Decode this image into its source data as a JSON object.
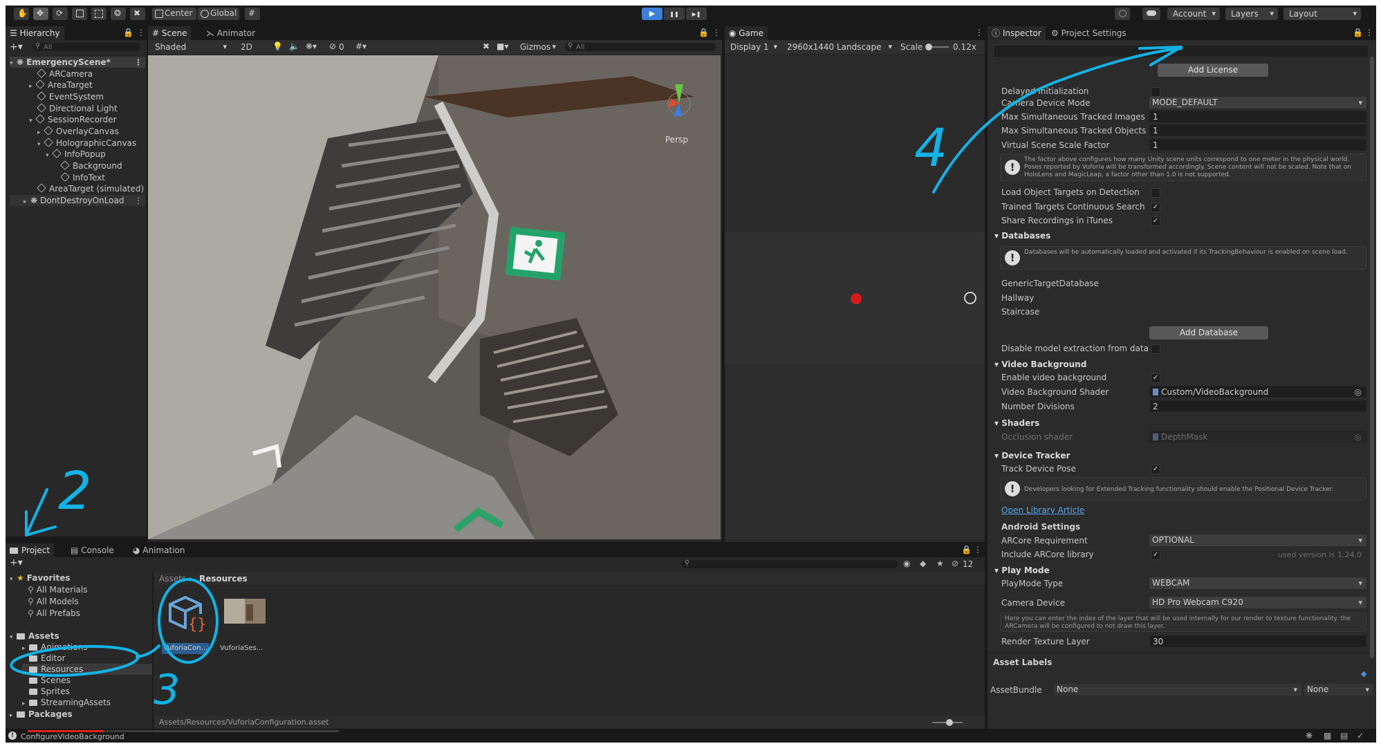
{
  "toolbar": {
    "pivot_label": "Center",
    "space_label": "Global",
    "play_icon": "▶",
    "pause_icon": "❚❚",
    "step_icon": "▶❚",
    "account_label": "Account",
    "layers_label": "Layers",
    "layout_label": "Layout"
  },
  "hierarchy": {
    "tab_label": "Hierarchy",
    "search_placeholder": "All",
    "items": [
      {
        "label": "EmergencyScene*"
      },
      {
        "label": "ARCamera"
      },
      {
        "label": "AreaTarget"
      },
      {
        "label": "EventSystem"
      },
      {
        "label": "Directional Light"
      },
      {
        "label": "SessionRecorder"
      },
      {
        "label": "OverlayCanvas"
      },
      {
        "label": "HolographicCanvas"
      },
      {
        "label": "InfoPopup"
      },
      {
        "label": "Background"
      },
      {
        "label": "InfoText"
      },
      {
        "label": "AreaTarget (simulated)"
      },
      {
        "label": "DontDestroyOnLoad"
      }
    ]
  },
  "scene": {
    "tab_scene": "Scene",
    "tab_animator": "Animator",
    "shading_mode": "Shaded",
    "mode_2d": "2D",
    "layer_count": "0",
    "gizmos_label": "Gizmos",
    "search_placeholder": "All",
    "persp_label": "Persp"
  },
  "game": {
    "tab_label": "Game",
    "display": "Display 1",
    "resolution": "2960x1440 Landscape",
    "scale_label": "Scale",
    "scale_value": "0.12x"
  },
  "inspector": {
    "tab_inspector": "Inspector",
    "tab_project_settings": "Project Settings",
    "add_license_button": "Add License",
    "fields": {
      "delayed_init_label": "Delayed Initialization",
      "camera_mode_label": "Camera Device Mode",
      "camera_mode_value": "MODE_DEFAULT",
      "max_images_label": "Max Simultaneous Tracked Images",
      "max_images_value": "1",
      "max_objects_label": "Max Simultaneous Tracked Objects",
      "max_objects_value": "1",
      "scale_factor_label": "Virtual Scene Scale Factor",
      "scale_factor_value": "1",
      "scale_help": "The factor above configures how many Unity scene units correspond to one meter in the physical world. Poses reported by Vuforia will be transformed accordingly. Scene content will not be scaled. Note that on HoloLens and MagicLeap, a factor other than 1.0 is not supported.",
      "load_object_targets_label": "Load Object Targets on Detection",
      "trained_targets_label": "Trained Targets Continuous Search",
      "share_recordings_label": "Share Recordings in iTunes"
    },
    "databases": {
      "header": "Databases",
      "help": "Databases will be automatically loaded and activated if its TrackingBehaviour is enabled on scene load.",
      "items": [
        "GenericTargetDatabase",
        "Hallway",
        "Staircase"
      ],
      "add_button": "Add Database",
      "disable_extraction_label": "Disable model extraction from database"
    },
    "video_background": {
      "header": "Video Background",
      "enable_label": "Enable video background",
      "shader_label": "Video Background Shader",
      "shader_value": "Custom/VideoBackground",
      "divisions_label": "Number Divisions",
      "divisions_value": "2"
    },
    "shaders": {
      "header": "Shaders",
      "occlusion_label": "Occlusion shader",
      "occlusion_value": "DepthMask"
    },
    "device_tracker": {
      "header": "Device Tracker",
      "track_pose_label": "Track Device Pose",
      "help": "Developers looking for Extended Tracking functionality should enable the Positional Device Tracker.",
      "link": "Open Library Article"
    },
    "android": {
      "header": "Android Settings",
      "arcore_req_label": "ARCore Requirement",
      "arcore_req_value": "OPTIONAL",
      "include_arcore_label": "Include ARCore library",
      "version_note": "used version is 1.24.0"
    },
    "play_mode": {
      "header": "Play Mode",
      "type_label": "PlayMode Type",
      "type_value": "WEBCAM",
      "camera_label": "Camera Device",
      "camera_value": "HD Pro Webcam C920",
      "help": "Here you can enter the index of the layer that will be used internally for our render to texture functionality. the ARCamera will be configured to not draw this layer.",
      "render_layer_label": "Render Texture Layer",
      "render_layer_value": "30"
    },
    "asset_labels": {
      "header": "Asset Labels",
      "bundle_label": "AssetBundle",
      "bundle_value": "None",
      "variant_value": "None"
    }
  },
  "project": {
    "tab_project": "Project",
    "tab_console": "Console",
    "tab_animation": "Animation",
    "visible_count": "12",
    "breadcrumb_root": "Assets",
    "breadcrumb_current": "Resources",
    "favorites_header": "Favorites",
    "favorites": [
      "All Materials",
      "All Models",
      "All Prefabs"
    ],
    "assets_header": "Assets",
    "asset_folders": [
      "Animations",
      "Editor",
      "Resources",
      "Scenes",
      "Sprites",
      "StreamingAssets"
    ],
    "packages_label": "Packages",
    "files": [
      {
        "label": "VuforiaCon..."
      },
      {
        "label": "VuforiaSes..."
      }
    ],
    "footer_path": "Assets/Resources/VuforiaConfiguration.asset"
  },
  "status": {
    "message": "ConfigureVideoBackground"
  },
  "annotations": {
    "note_2": "2",
    "note_3": "3",
    "note_4": "4"
  },
  "colors": {
    "accent_blue": "#3d7fd8",
    "annotation_cyan": "#12b3e6",
    "panel": "#282828",
    "toolbar": "#191919"
  }
}
